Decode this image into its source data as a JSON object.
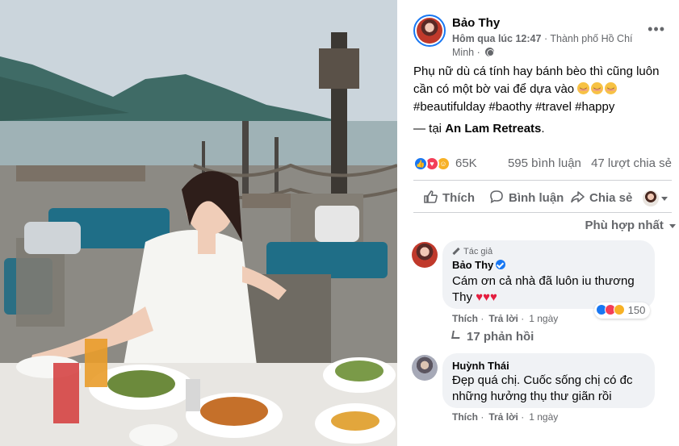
{
  "post": {
    "author": "Bảo Thy",
    "timestamp": "Hôm qua lúc 12:47",
    "location_city": "Thành phố Hồ Chí Minh",
    "caption_line1": "Phụ nữ dù cá tính hay bánh bèo thì cũng luôn cần có một bờ vai để dựa vào",
    "caption_hashtags": "#beautifulday #baothy #travel #happy",
    "checkin_prefix": "— tại",
    "checkin_place": "An Lam Retreats",
    "checkin_suffix": "."
  },
  "reactions": {
    "count": "65K",
    "comments": "595 bình luận",
    "shares": "47 lượt chia sẻ"
  },
  "actions": {
    "like": "Thích",
    "comment": "Bình luận",
    "share": "Chia sẻ"
  },
  "sort": {
    "label": "Phù hợp nhất"
  },
  "comments": [
    {
      "author_tag": "Tác giả",
      "author": "Bảo Thy",
      "text": "Cám ơn cả nhà đã luôn iu thương Thy",
      "hearts": "♥♥♥",
      "like": "Thích",
      "reply": "Trả lời",
      "time": "1 ngày",
      "reaction_count": "150",
      "replies": "17 phản hồi"
    },
    {
      "author": "Huỳnh Thái",
      "text": "Đẹp quá chị. Cuốc sống chị có đc những hưởng thụ thư giãn rồi",
      "like": "Thích",
      "reply": "Trả lời",
      "time": "1 ngày"
    }
  ],
  "colors": {
    "accent": "#1877f2",
    "love": "#f33e58",
    "care": "#f7b125",
    "muted_text": "#65676b",
    "bubble": "#f0f2f5"
  }
}
